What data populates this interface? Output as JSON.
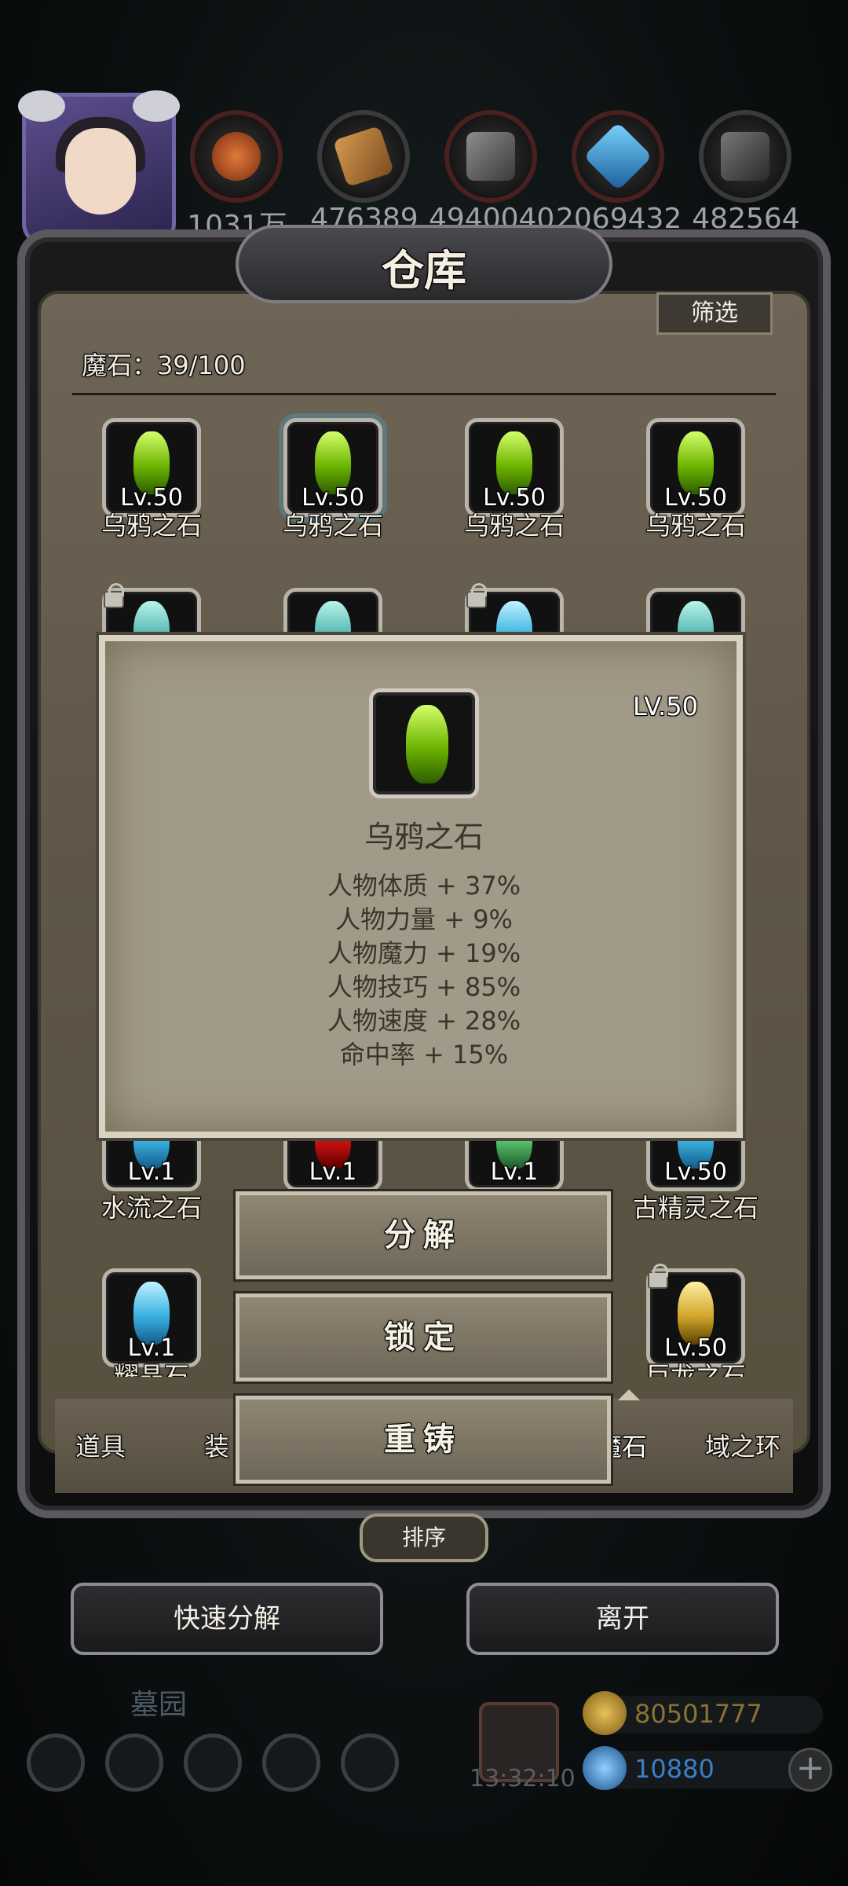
{
  "resources": [
    {
      "icon": "meat-icon",
      "value": "1031万"
    },
    {
      "icon": "wood-icon",
      "value": "476389"
    },
    {
      "icon": "iron-icon",
      "value": "4940040"
    },
    {
      "icon": "crystal-icon",
      "value": "2069432"
    },
    {
      "icon": "ore-icon",
      "value": "482564"
    }
  ],
  "panel": {
    "title": "仓库",
    "filter_label": "筛选",
    "stone_count": "魔石：39/100"
  },
  "items_row1": [
    {
      "level": "Lv.50",
      "name": "乌鸦之石"
    },
    {
      "level": "Lv.50",
      "name": "乌鸦之石"
    },
    {
      "level": "Lv.50",
      "name": "乌鸦之石"
    },
    {
      "level": "Lv.50",
      "name": "乌鸦之石"
    }
  ],
  "items_row3": [
    {
      "level": "Lv.1",
      "name": "水流之石"
    },
    {
      "level": "Lv.1",
      "name": ""
    },
    {
      "level": "Lv.1",
      "name": ""
    },
    {
      "level": "Lv.50",
      "name": "古精灵之石"
    }
  ],
  "items_row4": [
    {
      "level": "Lv.1",
      "name": "耀晶石"
    },
    {
      "level": "Lv.50",
      "name": "巨龙之石"
    }
  ],
  "tooltip": {
    "level": "LV.50",
    "name": "乌鸦之石",
    "stats": [
      "人物体质 + 37%",
      "人物力量 + 9%",
      "人物魔力 + 19%",
      "人物技巧 + 85%",
      "人物速度 + 28%",
      "命中率 + 15%"
    ]
  },
  "actions": {
    "decompose": "分解",
    "lock": "锁定",
    "reforge": "重铸"
  },
  "tabs": [
    "道具",
    "装",
    "魔石",
    "域之环"
  ],
  "sort_label": "排序",
  "quick_decompose": "快速分解",
  "leave": "离开",
  "bottom": {
    "location": "墓园",
    "timer": "13:32:10",
    "gold": "80501777",
    "gems": "10880"
  },
  "colors": {
    "gold": "#c8a03a",
    "gem_blue": "#3a7fc8"
  }
}
